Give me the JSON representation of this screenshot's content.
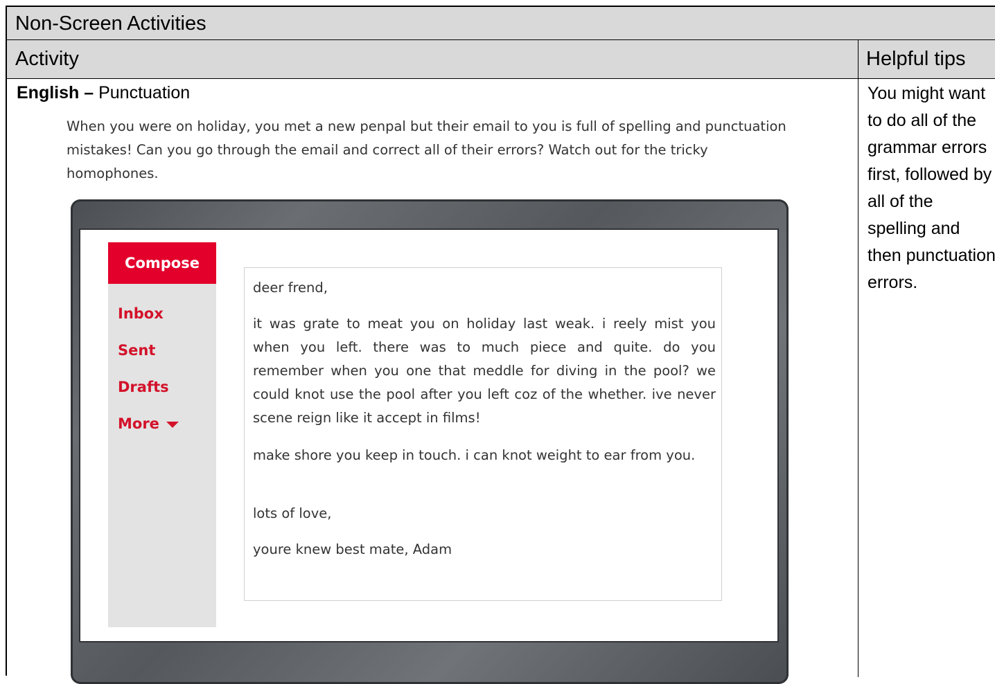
{
  "header": {
    "title": "Non-Screen Activities",
    "col_activity": "Activity",
    "col_tips": "Helpful tips"
  },
  "activity": {
    "subject": "English –",
    "topic": "Punctuation",
    "intro": "When you were on holiday, you met a new penpal but their email to you is full of spelling and punctuation mistakes! Can you go through the email and correct all of their errors? Watch out for the tricky homophones."
  },
  "email_client": {
    "compose_label": "Compose",
    "folders": [
      "Inbox",
      "Sent",
      "Drafts",
      "More"
    ],
    "icons": {
      "more": "caret-down-icon"
    },
    "accent_color": "#e3002b"
  },
  "email": {
    "greeting": "deer frend,",
    "body_1": "it was grate to meat you on holiday last weak. i reely mist you when you left. there was to much piece and quite. do you remember when you one that meddle for diving in the pool? we could knot use the pool after you left coz of the whether. ive never scene reign like it accept in films!",
    "body_2": "make shore you keep in touch. i can knot weight to ear from you.",
    "signoff": "lots of love,",
    "signature": "youre knew best mate, Adam"
  },
  "tips": {
    "text": "You might want to do all of the grammar errors first, followed by all of the spelling and then punctuation errors."
  }
}
